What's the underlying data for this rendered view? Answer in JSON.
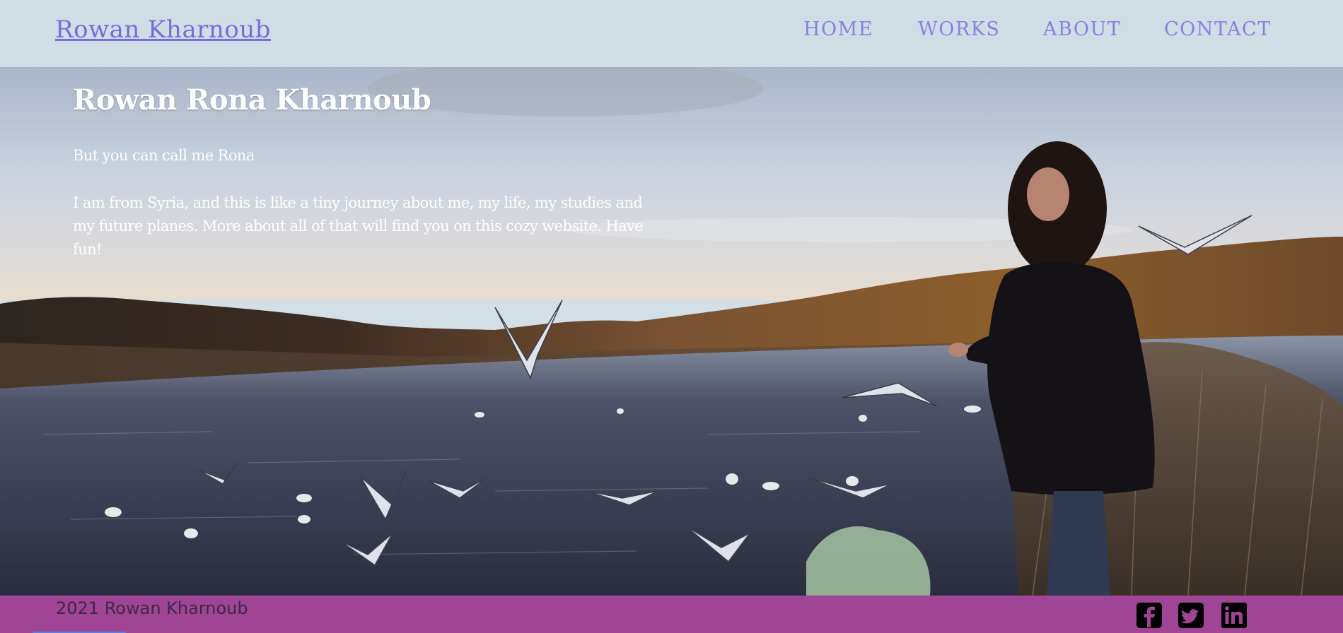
{
  "header": {
    "brand": "Rowan Kharnoub",
    "nav": [
      {
        "id": "home",
        "label": "HOME"
      },
      {
        "id": "works",
        "label": "WORKS"
      },
      {
        "id": "about",
        "label": "ABOUT"
      },
      {
        "id": "contact",
        "label": "CONTACT"
      }
    ]
  },
  "hero": {
    "title": "Rowan Rona Kharnoub",
    "subtitle": "But you can call me Rona",
    "paragraph": "I am from Syria, and this is like a tiny journey about me, my life, my studies and my future planes. More about all of that will find you on this cozy website. Have fun!"
  },
  "footer": {
    "copyright": "2021 Rowan Kharnoub",
    "social": [
      {
        "icon": "facebook-icon"
      },
      {
        "icon": "twitter-icon"
      },
      {
        "icon": "linkedin-icon"
      }
    ]
  },
  "colors": {
    "brand": "#6b6fe0",
    "nav": "#7b86e4",
    "footer_bg": "#a04596",
    "header_bg": "#d0dde5"
  }
}
